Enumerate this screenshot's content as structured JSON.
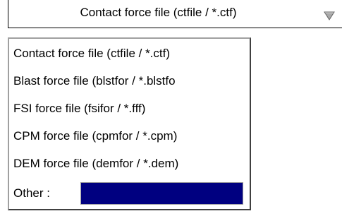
{
  "combo": {
    "selected_label": "Contact force file (ctfile / *.ctf)",
    "arrow_icon": "dropdown-triangle-icon"
  },
  "options": [
    {
      "label": "Contact force file (ctfile / *.ctf)"
    },
    {
      "label": "Blast force file (blstfor / *.blstfo"
    },
    {
      "label": "FSI force file (fsifor / *.fff)"
    },
    {
      "label": "CPM force file (cpmfor / *.cpm)"
    },
    {
      "label": "DEM force file (demfor / *.dem)"
    }
  ],
  "other": {
    "label": "Other :",
    "value": ""
  },
  "colors": {
    "input_background": "#000080",
    "arrow": "#808080"
  }
}
